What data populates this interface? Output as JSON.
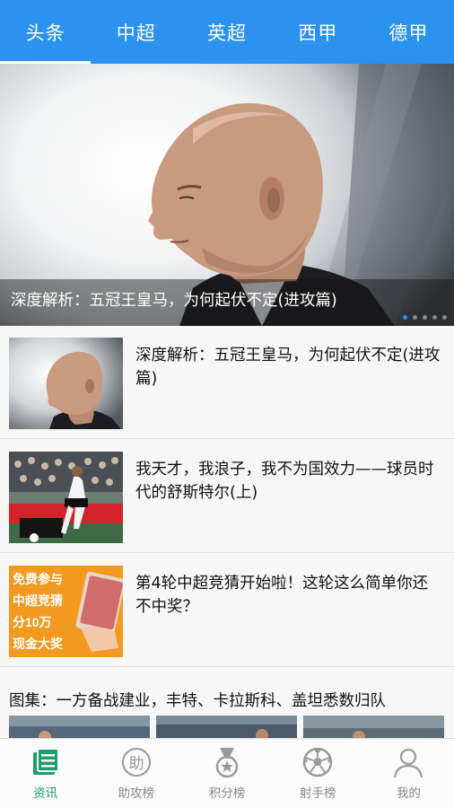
{
  "tabs": [
    {
      "label": "头条",
      "active": true
    },
    {
      "label": "中超",
      "active": false
    },
    {
      "label": "英超",
      "active": false
    },
    {
      "label": "西甲",
      "active": false
    },
    {
      "label": "德甲",
      "active": false
    }
  ],
  "hero": {
    "caption": "深度解析：五冠王皇马，为何起伏不定(进攻篇)",
    "slide_count": 5,
    "active_slide": 1
  },
  "news": [
    {
      "title": "深度解析：五冠王皇马，为何起伏不定(进攻篇)",
      "thumb": "bald-coach-portrait"
    },
    {
      "title": "我天才，我浪子，我不为国效力——球员时代的舒斯特尔(上)",
      "thumb": "footballer-in-stadium"
    },
    {
      "title": "第4轮中超竞猜开始啦！这轮这么简单你还不中奖？",
      "thumb": "promo-banner"
    }
  ],
  "promo_banner": {
    "lines": [
      "免费参与",
      "中超竞猜",
      "分10万",
      "现金大奖"
    ]
  },
  "gallery": {
    "title": "图集：一方备战建业，丰特、卡拉斯科、盖坦悉数归队"
  },
  "bottom_nav": [
    {
      "label": "资讯",
      "icon": "news-icon",
      "active": true
    },
    {
      "label": "助攻榜",
      "icon": "assist-icon",
      "active": false
    },
    {
      "label": "积分榜",
      "icon": "medal-icon",
      "active": false
    },
    {
      "label": "射手榜",
      "icon": "soccer-ball-icon",
      "active": false
    },
    {
      "label": "我的",
      "icon": "user-icon",
      "active": false
    }
  ],
  "colors": {
    "brand_blue": "#2b92f0",
    "nav_active": "#1b9e6a",
    "nav_inactive": "#888888"
  }
}
